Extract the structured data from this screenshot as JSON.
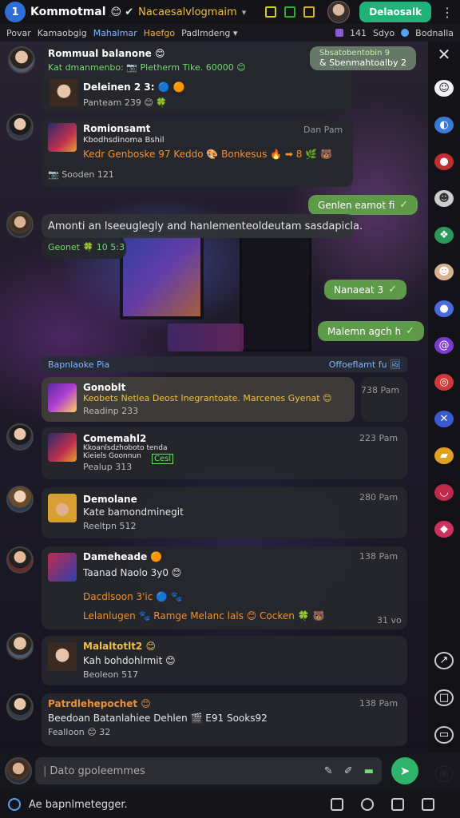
{
  "topbar": {
    "app_title": "Kommotmal",
    "title_emoji": "😊 ✔",
    "subtitle": "Nacaesalvlogmaim",
    "subtitle_chevron": "▾",
    "cta_label": "Delaosalk",
    "more": "⋮"
  },
  "subbar": {
    "tabs": [
      "Povar",
      "Kamaobgig",
      "Mahalmar",
      "Haefgo",
      "Padlmdeng ▾"
    ],
    "right_items": [
      "141",
      "Sdyo",
      "Bodnalla"
    ]
  },
  "messages": {
    "m1": {
      "name": "Rommual balanone 😊",
      "line1": "Kat dmanmenbo: 📷 Pletherm Tike. 60000 😊",
      "quoted_name": "Deleinen 2 3: 🔵 🟠",
      "quoted_meta": "Panteam 239 😊 🍀"
    },
    "m1_out": {
      "line1": "Sbsatobentobin 9",
      "line2": "& Sbenmahtoalby 2"
    },
    "m2": {
      "name": "Romionsamt",
      "line1": "Kbodhsdinoma Bshil",
      "line2": "Kedr Genboske 97 Keddo 🎨 Bonkesus 🔥 ➡ 8 🌿 🐻",
      "meta": "📷 Sooden 121",
      "time": "Dan Pam"
    },
    "out1": {
      "text": "Genlen eamot fi"
    },
    "m3": {
      "line1": "Amonti an  lseeuglegly and hanlementeoldeutam sasdapicla.",
      "meta": "Geonet 🍀 10 5:3"
    },
    "out2": {
      "text": "Nanaeat 3"
    },
    "out3": {
      "text": "Malemn agch h"
    },
    "divider": {
      "left": "Bapnlaoke Pia",
      "right": "Offoeflamt fu 🖼"
    },
    "m4": {
      "name": "Gonoblt",
      "line1": "Keobets Netlea Deost Inegrantoate. Marcenes Gyenat 😊",
      "meta": "Readinp 233",
      "time": "738 Pam"
    },
    "m5": {
      "name": "Comemahl2",
      "line1": "Kkoanlsdzhoboto tenda",
      "line2": "Kieiels Goonnun",
      "line3": "Cesl",
      "meta": "Pealup 313",
      "time": "223 Pam"
    },
    "m6": {
      "name": "Demolane",
      "line1": "Kate bamondminegit",
      "meta": "Reeltpn 512",
      "time": "280 Pam"
    },
    "m7": {
      "name": "Dameheade 🟠",
      "line1": "Taanad Naolo 3y0 😊",
      "line2": "Dacdlsoon 3'ic 🔵 🐾",
      "line3": "Lelanlugen 🐾 Ramge Melanc lals 😊 Cocken 🍀 🐻",
      "time1": "138 Pam",
      "time2": "31 vo"
    },
    "m8": {
      "name": "Malaltotlt2 😊",
      "line1": "Kah bohdohlrmit 😊",
      "meta": "Beoleon 517"
    },
    "m9": {
      "name": "Patrdlehepochet 😊",
      "line1": "Beedoan Batanlahiee Dehlen 🎬 E91 Sooks92",
      "meta": "Fealloon 😊 32",
      "time": "138 Pam"
    }
  },
  "composer": {
    "placeholder": "Dato gpoleemmes",
    "bottom_hint": "Ae bapnlmetegger."
  },
  "colors": {
    "accent": "#1fb37a",
    "outgoing": "#5f9a4a",
    "bubble": "#26282c",
    "highlight": "#f0c040"
  }
}
